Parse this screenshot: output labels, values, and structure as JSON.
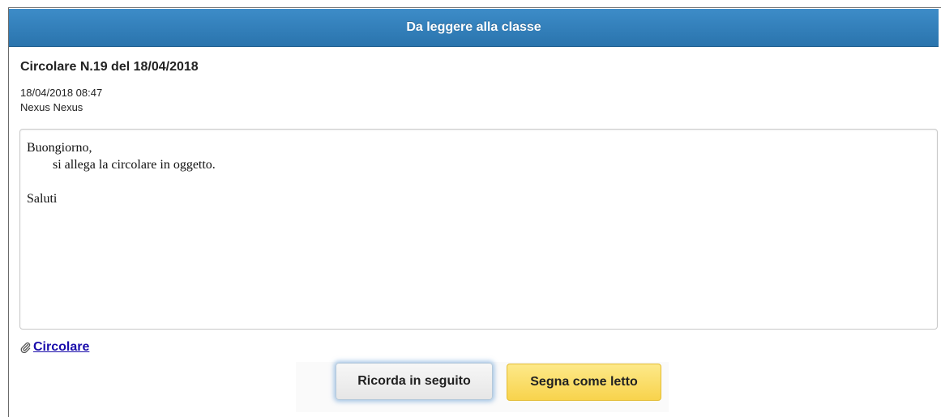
{
  "dialog": {
    "header_title": "Da leggere alla classe"
  },
  "message": {
    "title": "Circolare N.19 del 18/04/2018",
    "datetime": "18/04/2018 08:47",
    "author": "Nexus Nexus",
    "body": "Buongiorno,\n        si allega la circolare in oggetto.\n\nSaluti"
  },
  "attachment": {
    "icon": "paperclip-icon",
    "label": "Circolare"
  },
  "actions": {
    "remind_label": "Ricorda in seguito",
    "mark_read_label": "Segna come letto"
  },
  "colors": {
    "header": "#2f7dba",
    "link": "#1a0dab",
    "mark_read_button": "#f9d95e"
  }
}
